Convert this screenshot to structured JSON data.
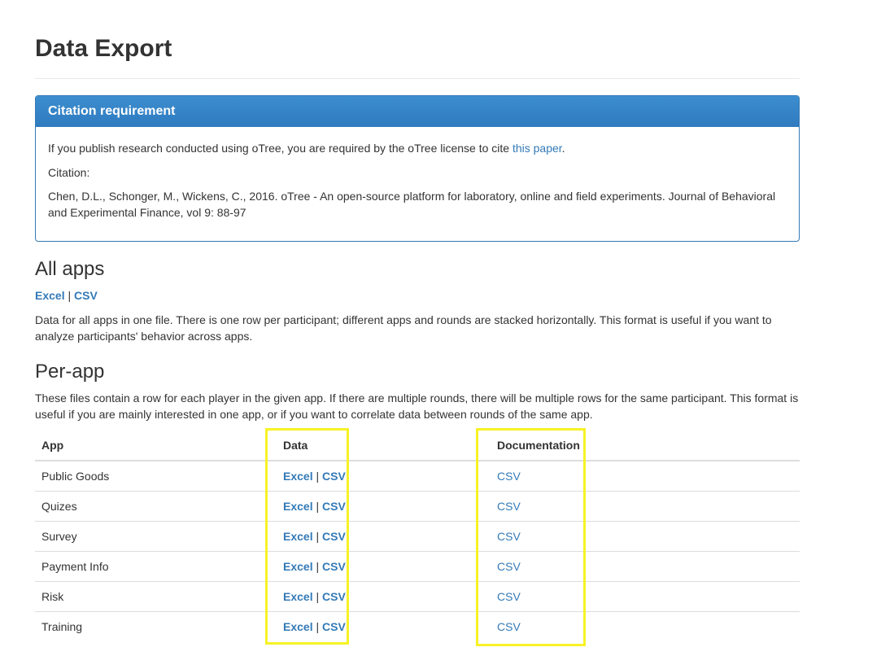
{
  "page": {
    "title": "Data Export"
  },
  "citation": {
    "heading": "Citation requirement",
    "line1_prefix": "If you publish research conducted using oTree, you are required by the oTree license to cite ",
    "line1_link": "this paper",
    "line1_suffix": ".",
    "label": "Citation:",
    "text": "Chen, D.L., Schonger, M., Wickens, C., 2016. oTree - An open-source platform for laboratory, online and field experiments. Journal of Behavioral and Experimental Finance, vol 9: 88-97"
  },
  "all_apps": {
    "heading": "All apps",
    "excel_label": "Excel",
    "separator": "|",
    "csv_label": "CSV",
    "description": "Data for all apps in one file. There is one row per participant; different apps and rounds are stacked horizontally. This format is useful if you want to analyze participants' behavior across apps."
  },
  "per_app": {
    "heading": "Per-app",
    "description": "These files contain a row for each player in the given app. If there are multiple rounds, there will be multiple rows for the same participant. This format is useful if you are mainly interested in one app, or if you want to correlate data between rounds of the same app.",
    "columns": {
      "app": "App",
      "data": "Data",
      "documentation": "Documentation"
    },
    "rows": [
      {
        "app": "Public Goods",
        "excel": "Excel",
        "sep": "|",
        "csv": "CSV",
        "doc": "CSV"
      },
      {
        "app": "Quizes",
        "excel": "Excel",
        "sep": "|",
        "csv": "CSV",
        "doc": "CSV"
      },
      {
        "app": "Survey",
        "excel": "Excel",
        "sep": "|",
        "csv": "CSV",
        "doc": "CSV"
      },
      {
        "app": "Payment Info",
        "excel": "Excel",
        "sep": "|",
        "csv": "CSV",
        "doc": "CSV"
      },
      {
        "app": "Risk",
        "excel": "Excel",
        "sep": "|",
        "csv": "CSV",
        "doc": "CSV"
      },
      {
        "app": "Training",
        "excel": "Excel",
        "sep": "|",
        "csv": "CSV",
        "doc": "CSV"
      }
    ]
  },
  "colors": {
    "link": "#337ab7",
    "panel_heading": "#337ab7",
    "highlight": "#f7f226"
  }
}
